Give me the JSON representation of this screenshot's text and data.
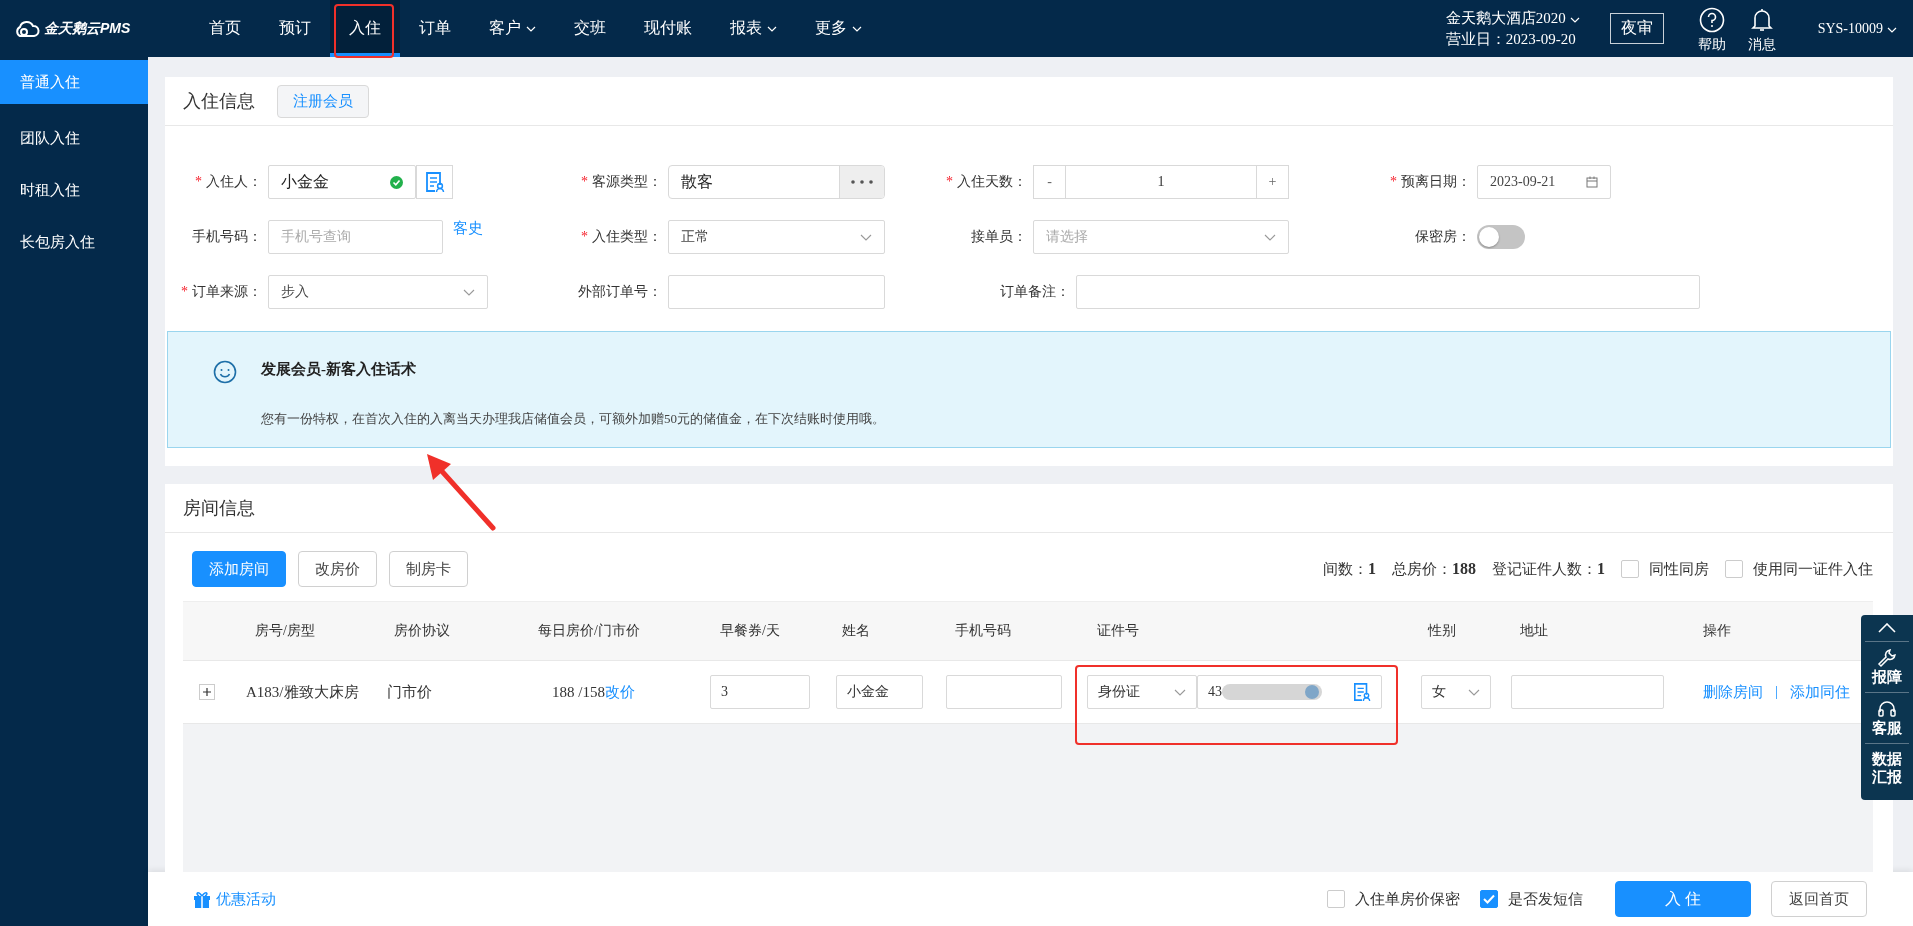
{
  "logo": "金天鹅云PMS",
  "nav": [
    {
      "label": "首页",
      "selected": false,
      "dropdown": false
    },
    {
      "label": "预订",
      "selected": false,
      "dropdown": false
    },
    {
      "label": "入住",
      "selected": true,
      "dropdown": false
    },
    {
      "label": "订单",
      "selected": false,
      "dropdown": false
    },
    {
      "label": "客户",
      "selected": false,
      "dropdown": true
    },
    {
      "label": "交班",
      "selected": false,
      "dropdown": false
    },
    {
      "label": "现付账",
      "selected": false,
      "dropdown": false
    },
    {
      "label": "报表",
      "selected": false,
      "dropdown": true
    },
    {
      "label": "更多",
      "selected": false,
      "dropdown": true
    }
  ],
  "hotel": {
    "name": "金天鹅大酒店2020",
    "business_date": "营业日：2023-09-20"
  },
  "night_audit_button": "夜审",
  "help": "帮助",
  "messages": "消息",
  "user": "SYS-10009",
  "sidebar": [
    {
      "label": "普通入住",
      "selected": true
    },
    {
      "label": "团队入住",
      "selected": false
    },
    {
      "label": "时租入住",
      "selected": false
    },
    {
      "label": "长包房入住",
      "selected": false
    }
  ],
  "checkin": {
    "title": "入住信息",
    "register_button": "注册会员",
    "fields": [
      {
        "kind": "guest",
        "label": "入住人：",
        "required_mark": "*",
        "value": "小金金",
        "verified": true
      },
      {
        "kind": "dots-select",
        "label": "客源类型：",
        "required_mark": "*",
        "value": "散客"
      },
      {
        "kind": "stepper",
        "label": "入住天数：",
        "required_mark": "*",
        "minus": "-",
        "value": "1",
        "plus": "+"
      },
      {
        "kind": "date",
        "label": "预离日期：",
        "required_mark": "*",
        "value": "2023-09-21"
      },
      {
        "kind": "phone",
        "label": "手机号码：",
        "placeholder": "手机号查询",
        "link": "客史"
      },
      {
        "kind": "select",
        "label": "入住类型：",
        "required_mark": "*",
        "value": "正常"
      },
      {
        "kind": "select",
        "label": "接单员：",
        "placeholder": "请选择"
      },
      {
        "kind": "toggle",
        "label": "保密房：",
        "on": false
      },
      {
        "kind": "select",
        "label": "订单来源：",
        "required_mark": "*",
        "value": "步入"
      },
      {
        "kind": "text",
        "label": "外部订单号："
      },
      {
        "kind": "note",
        "label": "订单备注："
      }
    ]
  },
  "tip": {
    "title": "发展会员-新客入住话术",
    "text": "您有一份特权，在首次入住的入离当天办理我店储值会员，可额外加赠50元的储值金，在下次结账时使用哦。"
  },
  "rooms": {
    "title": "房间信息",
    "buttons": [
      {
        "label": "添加房间",
        "primary": true
      },
      {
        "label": "改房价",
        "primary": false
      },
      {
        "label": "制房卡",
        "primary": false
      }
    ],
    "stats": [
      {
        "label": "间数：",
        "value": "1"
      },
      {
        "label": "总房价：",
        "value": "188"
      },
      {
        "label": "登记证件人数：",
        "value": "1"
      }
    ],
    "options": [
      {
        "label": "同性同房",
        "checked": false
      },
      {
        "label": "使用同一证件入住",
        "checked": false
      }
    ],
    "columns": [
      "房号/房型",
      "房价协议",
      "每日房价/门市价",
      "早餐券/天",
      "姓名",
      "手机号码",
      "证件号",
      "性别",
      "地址",
      "操作"
    ],
    "rows": [
      {
        "room": "A183/雅致大床房",
        "agreement": "门市价",
        "price": "188 /158",
        "price_link": "改价",
        "breakfast": "3",
        "name": "小金金",
        "id_type": "身份证",
        "id_number": "43",
        "gender": "女",
        "actions": [
          "删除房间",
          "添加同住"
        ],
        "separator": "|"
      }
    ]
  },
  "side_tools": [
    {
      "kind": "wrench",
      "label": "报障"
    },
    {
      "kind": "headset",
      "label": "客服"
    },
    {
      "kind": "text",
      "label": "数据汇报"
    }
  ],
  "footer": {
    "promo_link": "优惠活动",
    "options": [
      {
        "label": "入住单房价保密",
        "checked": false
      },
      {
        "label": "是否发短信",
        "checked": true
      }
    ],
    "submit_button": "入 住",
    "back_button": "返回首页"
  }
}
